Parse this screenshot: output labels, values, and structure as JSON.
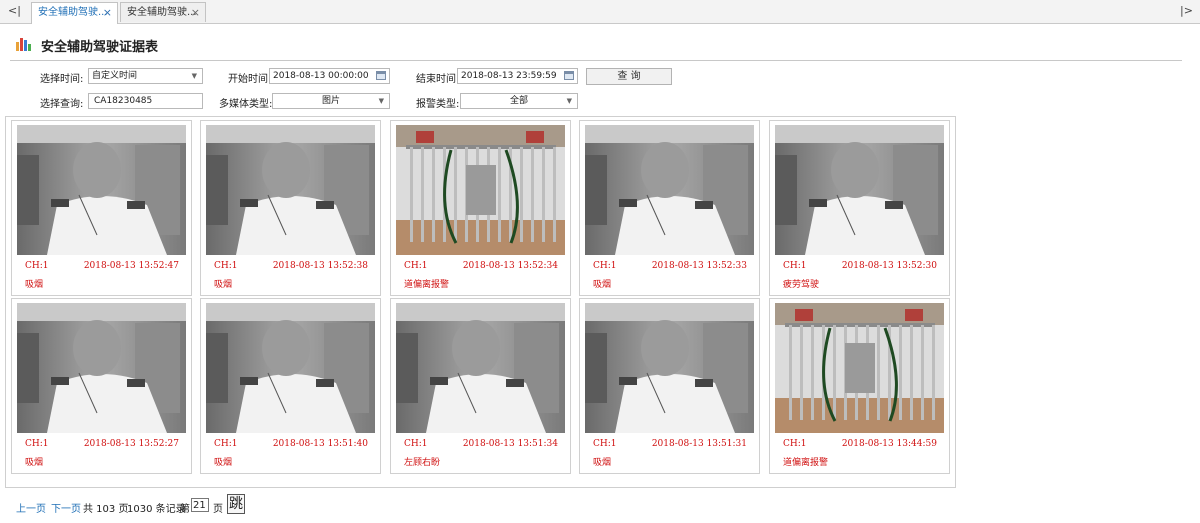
{
  "tabs": [
    {
      "label": "安全辅助驾驶...",
      "active": true
    },
    {
      "label": "安全辅助驾驶...",
      "active": false
    }
  ],
  "nav": {
    "left": "<|",
    "right": "|>"
  },
  "page_title": "安全辅助驾驶证据表",
  "filters": {
    "time_select_label": "选择时间:",
    "time_select_value": "自定义时间",
    "start_label": "开始时间:",
    "start_value": "2018-08-13 00:00:00",
    "end_label": "结束时间:",
    "end_value": "2018-08-13 23:59:59",
    "query_button": "查 询",
    "query_select_label": "选择查询:",
    "query_select_value": "CA18230485",
    "media_label": "多媒体类型:",
    "media_value": "图片",
    "alarm_label": "报警类型:",
    "alarm_value": "全部"
  },
  "cards": [
    {
      "channel": "CH:1",
      "time": "2018-08-13 13:52:47",
      "event": "吸烟",
      "scene": "driver"
    },
    {
      "channel": "CH:1",
      "time": "2018-08-13 13:52:38",
      "event": "吸烟",
      "scene": "driver"
    },
    {
      "channel": "CH:1",
      "time": "2018-08-13 13:52:34",
      "event": "道偏离报警",
      "scene": "gate"
    },
    {
      "channel": "CH:1",
      "time": "2018-08-13 13:52:33",
      "event": "吸烟",
      "scene": "driver"
    },
    {
      "channel": "CH:1",
      "time": "2018-08-13 13:52:30",
      "event": "疲劳驾驶",
      "scene": "driver"
    },
    {
      "channel": "CH:1",
      "time": "2018-08-13 13:52:27",
      "event": "吸烟",
      "scene": "driver"
    },
    {
      "channel": "CH:1",
      "time": "2018-08-13 13:51:40",
      "event": "吸烟",
      "scene": "driver"
    },
    {
      "channel": "CH:1",
      "time": "2018-08-13 13:51:34",
      "event": "左顾右盼",
      "scene": "driver"
    },
    {
      "channel": "CH:1",
      "time": "2018-08-13 13:51:31",
      "event": "吸烟",
      "scene": "driver"
    },
    {
      "channel": "CH:1",
      "time": "2018-08-13 13:44:59",
      "event": "道偏离报警",
      "scene": "gate"
    }
  ],
  "pager": {
    "prev": "上一页",
    "next": "下一页",
    "total_pages_text": "共 103 页",
    "total_records_text": "1030 条记录",
    "page_prefix": "第",
    "current_page": "21",
    "page_suffix": "页",
    "jump": "跳"
  },
  "colors": {
    "accent": "#1f6fb6",
    "alert": "#d01010"
  }
}
